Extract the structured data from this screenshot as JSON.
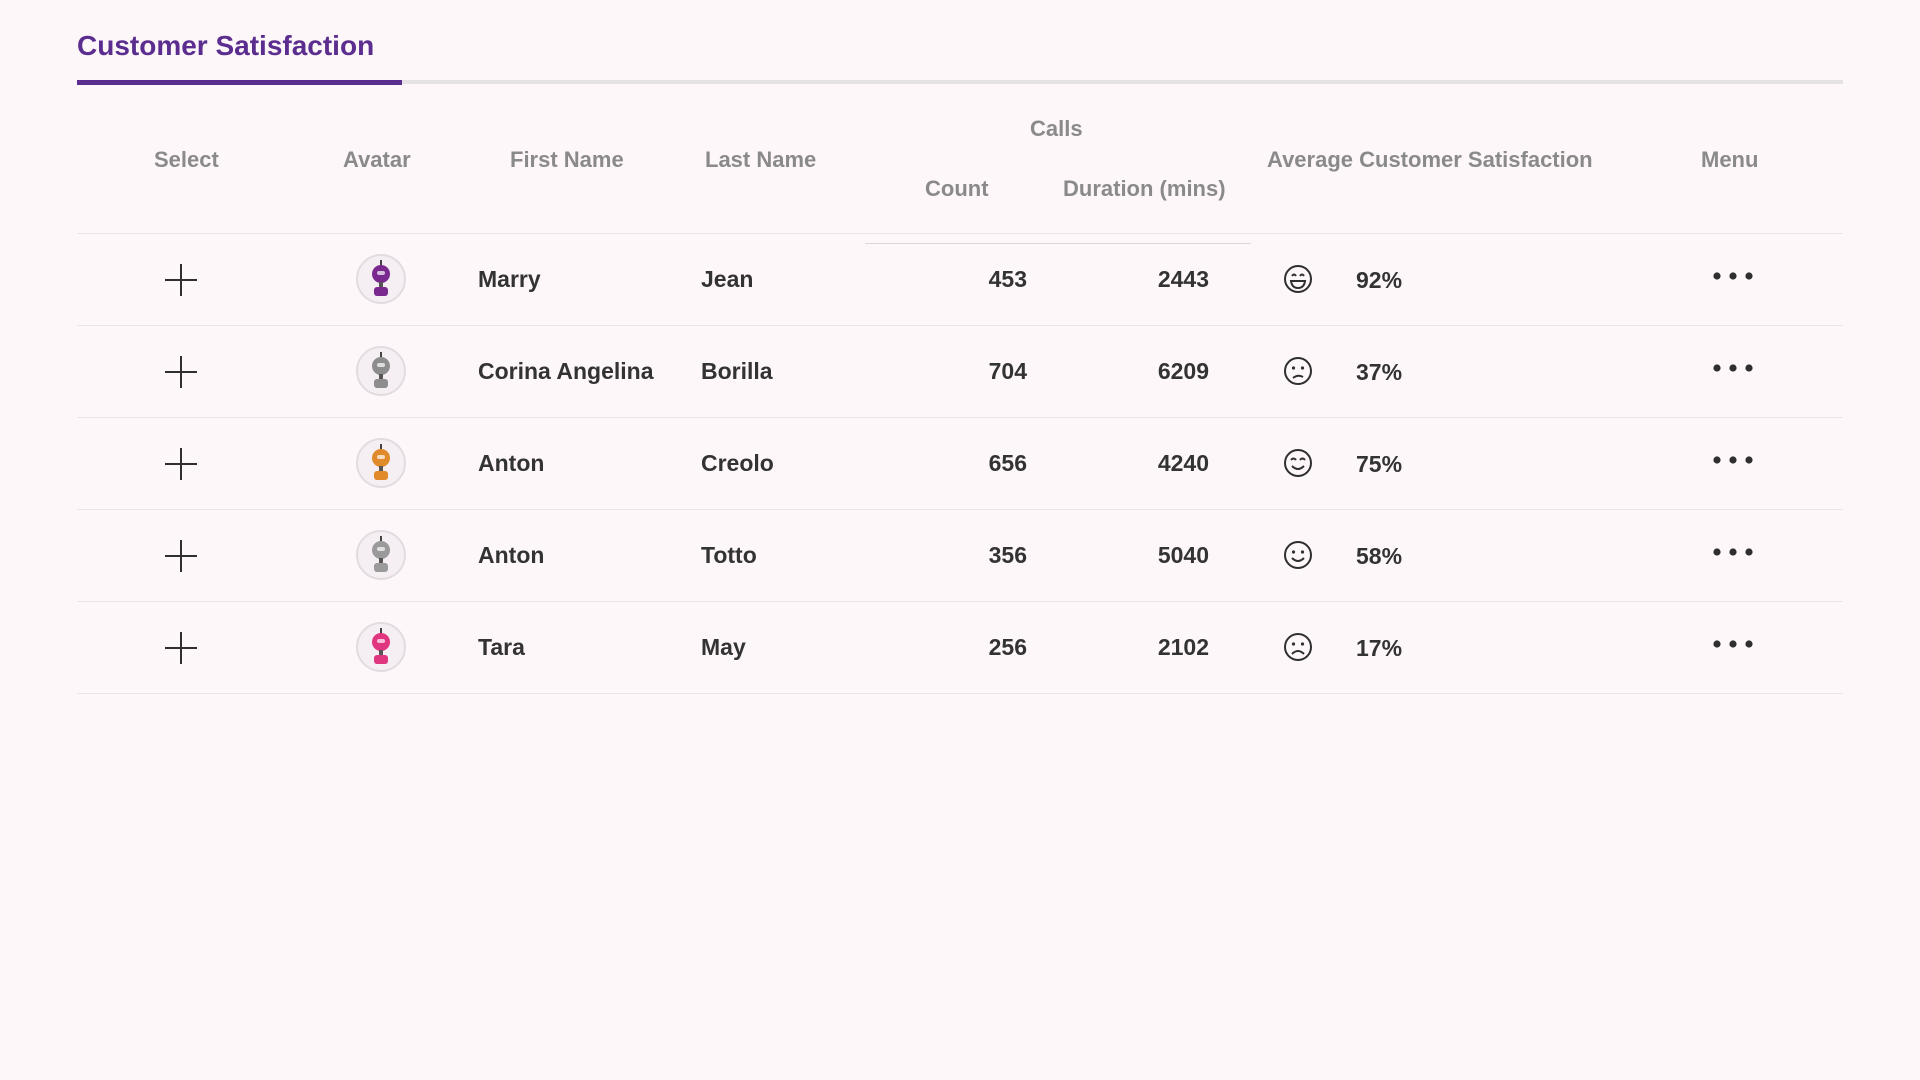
{
  "header": {
    "title": "Customer Satisfaction"
  },
  "columns": {
    "select": "Select",
    "avatar": "Avatar",
    "first_name": "First Name",
    "last_name": "Last Name",
    "calls": "Calls",
    "count": "Count",
    "duration": "Duration (mins)",
    "avg_satisfaction": "Average Customer Satisfaction",
    "menu": "Menu"
  },
  "rows": [
    {
      "first_name": "Marry",
      "last_name": "Jean",
      "count": "453",
      "duration": "2443",
      "satisfaction": "92%",
      "mood_icon": "laughing-face-icon",
      "avatar_color": "#7a2a8e"
    },
    {
      "first_name": "Corina Angelina",
      "last_name": "Borilla",
      "count": "704",
      "duration": "6209",
      "satisfaction": "37%",
      "mood_icon": "sad-face-icon",
      "avatar_color": "#8d8d8d"
    },
    {
      "first_name": "Anton",
      "last_name": "Creolo",
      "count": "656",
      "duration": "4240",
      "satisfaction": "75%",
      "mood_icon": "content-face-icon",
      "avatar_color": "#e08a2c"
    },
    {
      "first_name": "Anton",
      "last_name": "Totto",
      "count": "356",
      "duration": "5040",
      "satisfaction": "58%",
      "mood_icon": "smile-face-icon",
      "avatar_color": "#9a9a9a"
    },
    {
      "first_name": "Tara",
      "last_name": "May",
      "count": "256",
      "duration": "2102",
      "satisfaction": "17%",
      "mood_icon": "frown-face-icon",
      "avatar_color": "#e0357f"
    }
  ],
  "colors": {
    "accent": "#5b2d8e",
    "background": "#fdf7fa",
    "text": "#333333",
    "header_text": "#8a8a8a"
  }
}
